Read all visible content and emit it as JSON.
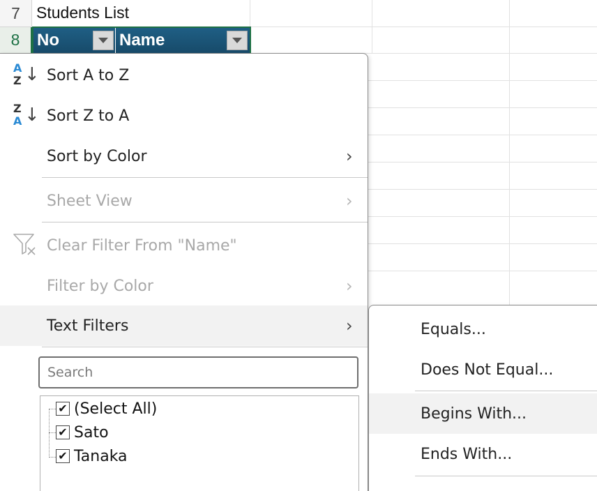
{
  "rows": [
    {
      "number": "7",
      "text": "Students List"
    },
    {
      "number": "8"
    }
  ],
  "table_headers": [
    {
      "label": "No"
    },
    {
      "label": "Name"
    }
  ],
  "menu": {
    "sort_az": {
      "label": "Sort A to Z",
      "icon": "sort-ascending-icon",
      "top_letter": "A",
      "bottom_letter": "Z"
    },
    "sort_za": {
      "label": "Sort Z to A",
      "icon": "sort-descending-icon",
      "top_letter": "Z",
      "bottom_letter": "A"
    },
    "sort_by_color": {
      "label": "Sort by Color",
      "arrow": "›"
    },
    "sheet_view": {
      "label": "Sheet View",
      "arrow": "›"
    },
    "clear_filter": {
      "label": "Clear Filter From \"Name\"",
      "icon": "clear-filter-icon"
    },
    "filter_by_color": {
      "label": "Filter by Color",
      "arrow": "›"
    },
    "text_filters": {
      "label": "Text Filters",
      "arrow": "›"
    },
    "search_placeholder": "Search",
    "list": [
      {
        "label": "(Select All)",
        "checked": true
      },
      {
        "label": "Sato",
        "checked": true
      },
      {
        "label": "Tanaka",
        "checked": true
      }
    ],
    "check_mark": "✔"
  },
  "submenu": {
    "items": [
      {
        "label": "Equals..."
      },
      {
        "label": "Does Not Equal..."
      },
      {
        "label": "Begins With..."
      },
      {
        "label": "Ends With..."
      }
    ]
  },
  "colors": {
    "header_fill": "#1a5478",
    "selection_border": "#1e7145",
    "sort_icon_accent": "#2a8ad4"
  }
}
